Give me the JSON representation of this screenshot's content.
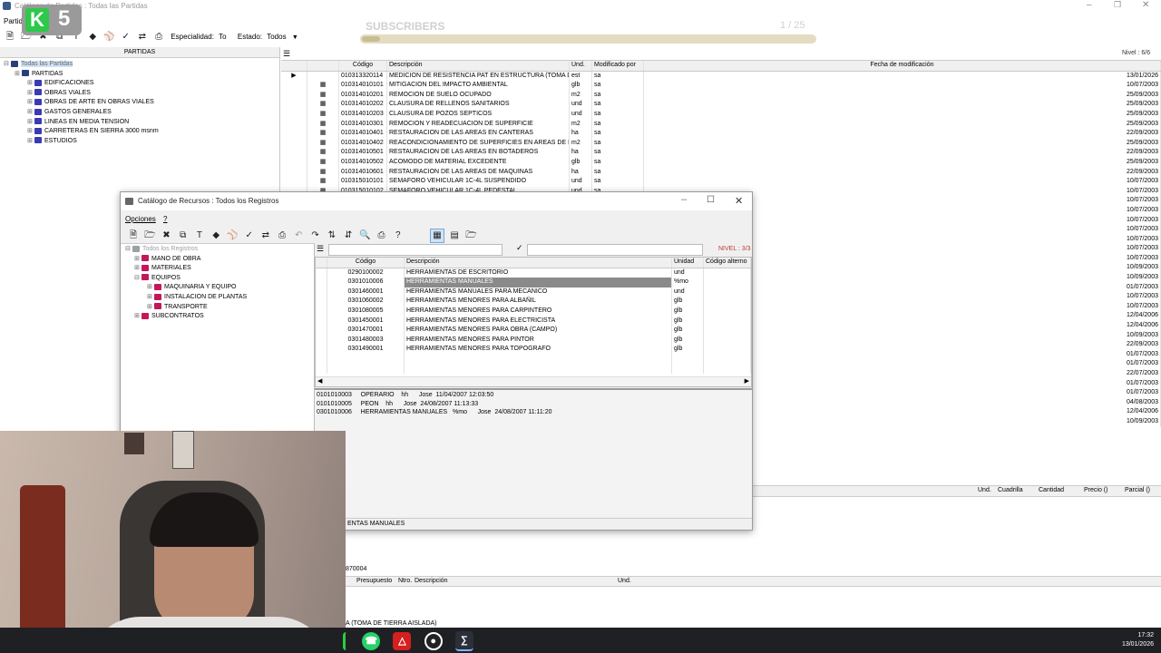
{
  "main_window": {
    "title": "Catálogo de Partidas  :  Todas las Partidas",
    "menu": [
      "Partida"
    ],
    "toolbar": {
      "especialidad_label": "Especialidad:",
      "especialidad_value": "To",
      "estado_label": "Estado:",
      "estado_value": "Todos"
    },
    "overlay": {
      "title": "SUBSCRIBERS",
      "counter": "1 / 25"
    },
    "left_header": "PARTIDAS",
    "nivel": "Nivel : 6/6",
    "tree": [
      {
        "label": "Todas las Partidas",
        "level": 0
      },
      {
        "label": "PARTIDAS",
        "level": 1
      },
      {
        "label": "EDIFICACIONES",
        "level": 2
      },
      {
        "label": "OBRAS VIALES",
        "level": 2
      },
      {
        "label": "OBRAS DE ARTE EN OBRAS VIALES",
        "level": 2
      },
      {
        "label": "GASTOS GENERALES",
        "level": 2
      },
      {
        "label": "LINEAS EN MEDIA TENSION",
        "level": 2
      },
      {
        "label": "CARRETERAS EN SIERRA 3000 msnm",
        "level": 2
      },
      {
        "label": "ESTUDIOS",
        "level": 2
      }
    ],
    "grid": {
      "columns": [
        "Código",
        "Descripción",
        "Und.",
        "Modificado por",
        "Fecha de modificación"
      ],
      "rows": [
        [
          "010313320114",
          "MEDICION DE RESISTENCIA PAT EN ESTRUCTURA (TOMA DE T",
          "est",
          "sa",
          "13/01/2026"
        ],
        [
          "010314010101",
          "MITIGACION DEL IMPACTO AMBIENTAL",
          "glb",
          "sa",
          "10/07/2003"
        ],
        [
          "010314010201",
          "REMOCION DE SUELO OCUPADO",
          "m2",
          "sa",
          "25/09/2003"
        ],
        [
          "010314010202",
          "CLAUSURA DE RELLENOS SANITARIOS",
          "und",
          "sa",
          "25/09/2003"
        ],
        [
          "010314010203",
          "CLAUSURA DE POZOS SEPTICOS",
          "und",
          "sa",
          "25/09/2003"
        ],
        [
          "010314010301",
          "REMOCION Y READECUACION DE SUPERFICIE",
          "m2",
          "sa",
          "25/09/2003"
        ],
        [
          "010314010401",
          "RESTAURACION DE LAS AREAS EN CANTERAS",
          "ha",
          "sa",
          "22/09/2003"
        ],
        [
          "010314010402",
          "REACONDICIONAMIENTO DE SUPERFICIES EN AREAS DE PRE",
          "m2",
          "sa",
          "25/09/2003"
        ],
        [
          "010314010501",
          "RESTAURACION DE LAS AREAS EN BOTADEROS",
          "ha",
          "sa",
          "22/09/2003"
        ],
        [
          "010314010502",
          "ACOMODO DE MATERIAL EXCEDENTE",
          "glb",
          "sa",
          "25/09/2003"
        ],
        [
          "010314010601",
          "RESTAURACION DE LAS AREAS DE MAQUINAS",
          "ha",
          "sa",
          "22/09/2003"
        ],
        [
          "010315010101",
          "SEMAFORO VEHICULAR 1C-4L SUSPENDIDO",
          "und",
          "sa",
          "10/07/2003"
        ],
        [
          "010315010102",
          "SEMAFORO VEHICULAR 1C-4L PEDESTAL",
          "und",
          "sa",
          "10/07/2003"
        ]
      ],
      "extra_dates": [
        "10/07/2003",
        "10/07/2003",
        "10/07/2003",
        "10/07/2003",
        "10/07/2003",
        "10/07/2003",
        "10/07/2003",
        "10/09/2003",
        "10/09/2003",
        "01/07/2003",
        "10/07/2003",
        "10/07/2003",
        "12/04/2006",
        "12/04/2006",
        "10/09/2003",
        "22/09/2003",
        "01/07/2003",
        "01/07/2003",
        "22/07/2003",
        "01/07/2003",
        "01/07/2003",
        "04/08/2003",
        "12/04/2006",
        "10/09/2003"
      ]
    },
    "lower_grid_columns": [
      "Und.",
      "Cuadrilla",
      "Cantidad",
      "Precio ()",
      "Parcial ()"
    ],
    "bottom_code": "870004",
    "bottom_grid_columns": [
      "Presupuesto",
      "Ntro.",
      "Descripción",
      "Und."
    ],
    "status_text": "A (TOMA DE TIERRA AISLADA)"
  },
  "dialog": {
    "title": "Catálogo de Recursos  :  Todos los Registros",
    "menu": [
      "Opciones",
      "?"
    ],
    "nivel": "NIVEL : 3/3",
    "tree": [
      {
        "label": "Todos los Registros",
        "level": 0,
        "color": "#9aa0a6"
      },
      {
        "label": "MANO DE OBRA",
        "level": 1,
        "color": "#c2185b"
      },
      {
        "label": "MATERIALES",
        "level": 1,
        "color": "#c2185b"
      },
      {
        "label": "EQUIPOS",
        "level": 1,
        "color": "#c2185b"
      },
      {
        "label": "MAQUINARIA Y EQUIPO",
        "level": 2,
        "color": "#c2185b"
      },
      {
        "label": "INSTALACION DE PLANTAS",
        "level": 2,
        "color": "#c2185b"
      },
      {
        "label": "TRANSPORTE",
        "level": 2,
        "color": "#c2185b"
      },
      {
        "label": "SUBCONTRATOS",
        "level": 1,
        "color": "#c2185b"
      }
    ],
    "grid": {
      "columns": [
        "Código",
        "Descripción",
        "Unidad",
        "Código alterno"
      ],
      "rows": [
        [
          "0290100002",
          "HERRAMIENTAS DE ESCRITORIO",
          "und",
          ""
        ],
        [
          "0301010006",
          "HERRAMIENTAS MANUALES",
          "%mo",
          ""
        ],
        [
          "0301460001",
          "HERRAMIENTAS MANUALES PARA MECANICO",
          "und",
          ""
        ],
        [
          "0301060002",
          "HERRAMIENTAS MENORES PARA ALBAÑIL",
          "glb",
          ""
        ],
        [
          "0301080005",
          "HERRAMIENTAS MENORES PARA CARPINTERO",
          "glb",
          ""
        ],
        [
          "0301450001",
          "HERRAMIENTAS MENORES PARA ELECTRICISTA",
          "glb",
          ""
        ],
        [
          "0301470001",
          "HERRAMIENTAS MENORES PARA OBRA (CAMPO)",
          "glb",
          ""
        ],
        [
          "0301480003",
          "HERRAMIENTAS MENORES PARA PINTOR",
          "glb",
          ""
        ],
        [
          "0301490001",
          "HERRAMIENTAS MENORES PARA TOPOGRAFO",
          "glb",
          ""
        ]
      ]
    },
    "log": [
      "0101010003     OPERARIO    hh      Jose  11/04/2007 12:03:50",
      "0101010005     PEON    hh      Jose  24/08/2007 11:13:33",
      "0301010006     HERRAMIENTAS MANUALES   %mo      Jose  24/08/2007 11:11:20"
    ],
    "status": "ENTAS MANUALES"
  },
  "taskbar": {
    "time": "17:32",
    "date": "13/01/2026"
  },
  "logo": {
    "text": "5"
  }
}
